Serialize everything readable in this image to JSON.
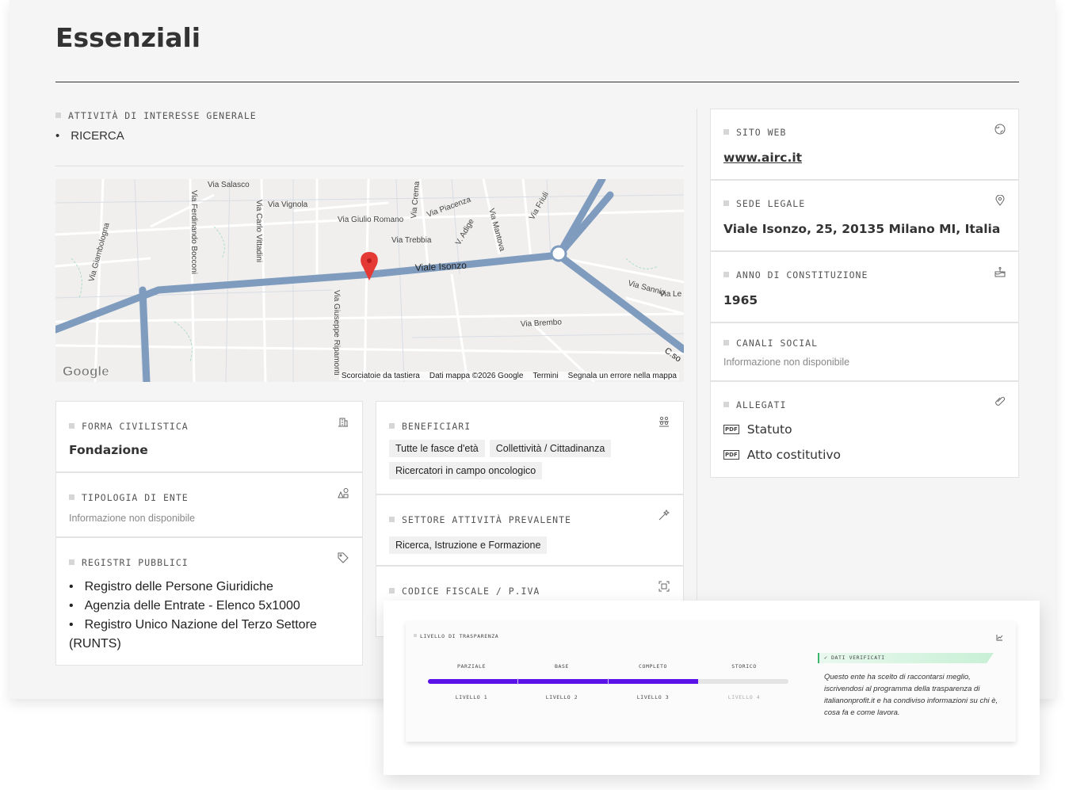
{
  "page": {
    "title": "Essenziali"
  },
  "interest": {
    "label": "ATTIVITÀ DI INTERESSE GENERALE",
    "items": [
      "RICERCA"
    ]
  },
  "map": {
    "streets": [
      "Via Salasco",
      "Via Ferdinando Bocconi",
      "Via Giambologna",
      "Via Vignola",
      "Via Carlo Vittadini",
      "Via Giuseppe Ripamonti",
      "Via Giulio Romano",
      "Via Crema",
      "Via Piacenza",
      "Via Trebbia",
      "V. Adige",
      "Via Mantova",
      "Via Friuli",
      "Viale Isonzo",
      "Via Sannio",
      "Via Brembo",
      "Via Le",
      "C.so"
    ],
    "footer": [
      "Scorciatoie da tastiera",
      "Dati mappa ©2026 Google",
      "Termini",
      "Segnala un errore nella mappa"
    ],
    "logo": "Google",
    "pin_color": "#e53935"
  },
  "cards": {
    "forma": {
      "label": "FORMA CIVILISTICA",
      "value": "Fondazione",
      "icon": "building-icon"
    },
    "tipologia": {
      "label": "TIPOLOGIA DI ENTE",
      "value": "Informazione non disponibile",
      "icon": "shapes-icon"
    },
    "registri": {
      "label": "REGISTRI PUBBLICI",
      "icon": "tag-icon",
      "items": [
        "Registro delle Persone Giuridiche",
        "Agenzia delle Entrate - Elenco 5x1000",
        "Registro Unico Nazione del Terzo Settore (RUNTS)"
      ]
    },
    "beneficiari": {
      "label": "BENEFICIARI",
      "icon": "people-icon",
      "chips": [
        "Tutte le fasce d'età",
        "Collettività / Cittadinanza",
        "Ricercatori in campo oncologico"
      ]
    },
    "settore": {
      "label": "SETTORE ATTIVITÀ PREVALENTE",
      "icon": "magic-wand-icon",
      "chips": [
        "Ricerca, Istruzione e Formazione"
      ]
    },
    "codice": {
      "label": "CODICE FISCALE / P.IVA",
      "icon": "scan-icon"
    }
  },
  "right": {
    "sito": {
      "label": "SITO WEB",
      "value": "www.airc.it",
      "icon": "globe-icon"
    },
    "sede": {
      "label": "SEDE LEGALE",
      "value": "Viale Isonzo, 25, 20135 Milano MI, Italia",
      "icon": "location-pin-icon"
    },
    "anno": {
      "label": "ANNO DI CONSTITUZIONE",
      "value": "1965",
      "icon": "cake-icon"
    },
    "social": {
      "label": "CANALI SOCIAL",
      "value": "Informazione non disponibile"
    },
    "allegati": {
      "label": "ALLEGATI",
      "icon": "paperclip-icon",
      "pdf_label": "PDF",
      "files": [
        "Statuto",
        "Atto costitutivo"
      ]
    }
  },
  "transparency": {
    "label": "LIVELLO DI TRASPARENZA",
    "icon": "chart-icon",
    "levels": [
      {
        "name": "PARZIALE",
        "sub": "LIVELLO 1"
      },
      {
        "name": "BASE",
        "sub": "LIVELLO 2"
      },
      {
        "name": "COMPLETO",
        "sub": "LIVELLO 3"
      },
      {
        "name": "STORICO",
        "sub": "LIVELLO 4"
      }
    ],
    "progress_fraction": 0.75,
    "bar_color": "#5b12e8",
    "verified_label": "DATI VERIFICATI",
    "verified_text": "Questo ente ha scelto di raccontarsi meglio, iscrivendosi al programma della trasparenza di italianonprofit.it e ha condiviso informazioni su chi è, cosa fa e come lavora."
  }
}
